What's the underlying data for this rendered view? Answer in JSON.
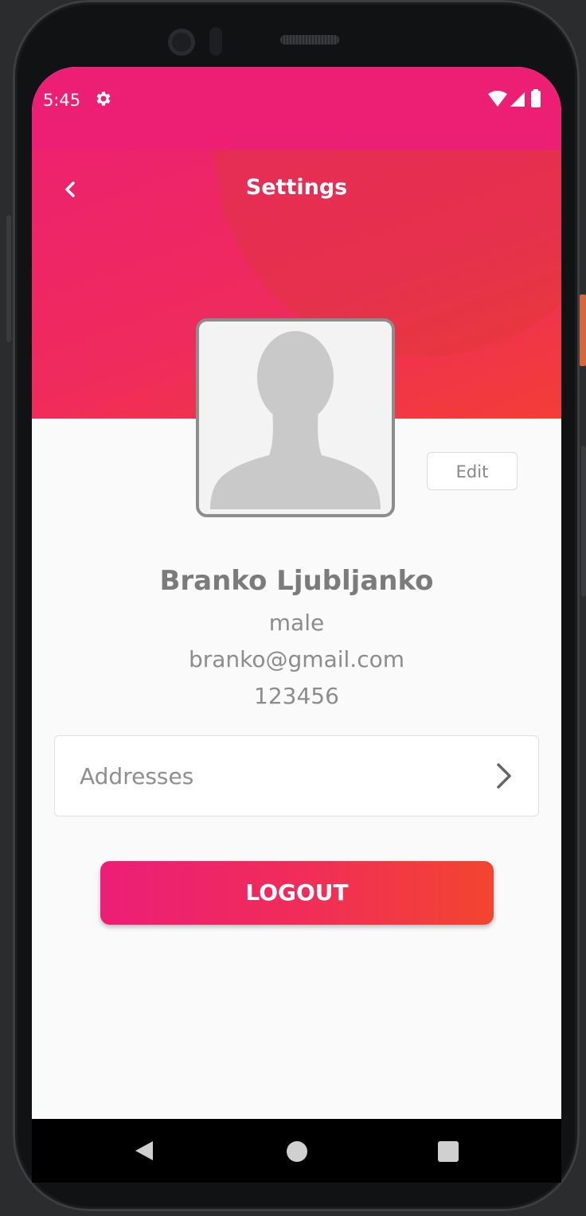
{
  "status_bar": {
    "time": "5:45",
    "icons": [
      "gear-icon",
      "wifi-icon",
      "signal-icon",
      "battery-icon"
    ]
  },
  "header": {
    "title": "Settings",
    "back_icon": "chevron-left-icon",
    "gradient_colors": [
      "#ec1f74",
      "#f33e36"
    ]
  },
  "profile": {
    "avatar_icon": "person-silhouette-icon",
    "edit_label": "Edit",
    "name": "Branko Ljubljanko",
    "gender": "male",
    "email": "branko@gmail.com",
    "phone": "123456"
  },
  "menu": {
    "addresses_label": "Addresses",
    "chevron_icon": "chevron-right-icon"
  },
  "actions": {
    "logout_label": "LOGOUT"
  },
  "nav_bar": {
    "icons": [
      "back-triangle-icon",
      "home-circle-icon",
      "recents-square-icon"
    ]
  }
}
